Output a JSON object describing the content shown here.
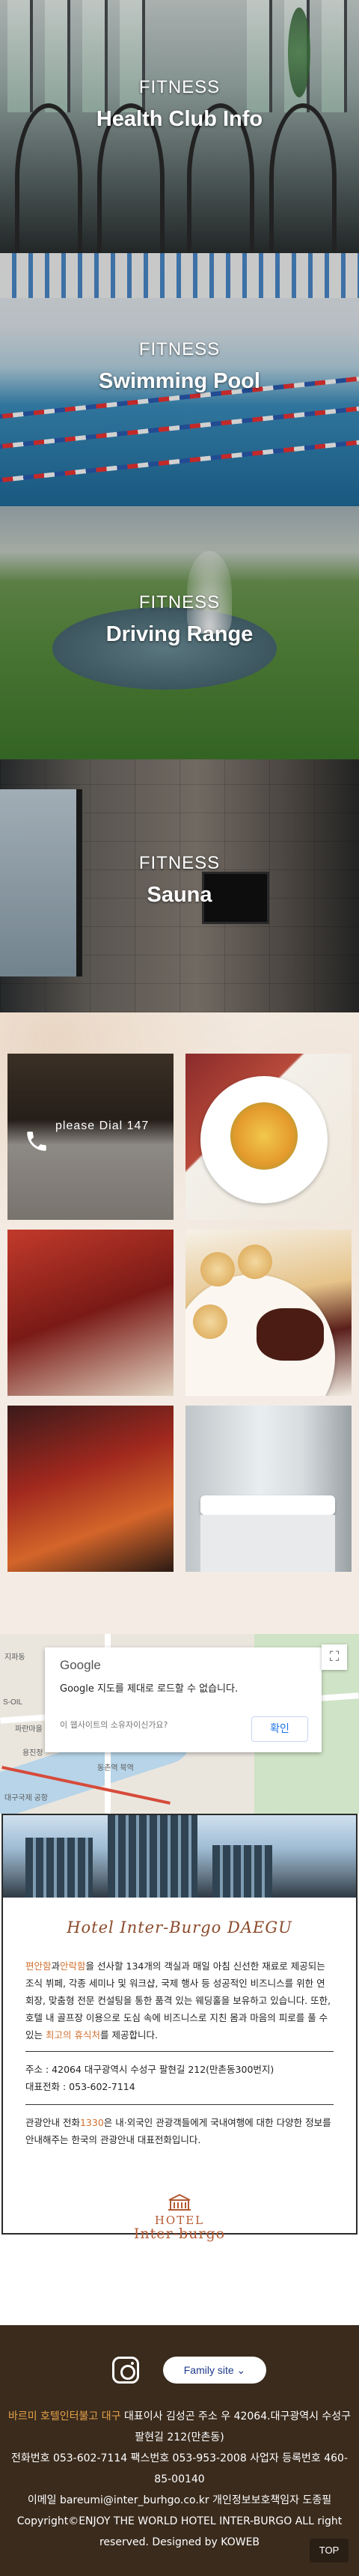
{
  "facilities": [
    {
      "kicker": "FITNESS",
      "title": "Hea­lth Club Info"
    },
    {
      "kicker": "FITNESS",
      "title": "Swimming Pool"
    },
    {
      "kicker": "FITNESS",
      "title": "Driving Range"
    },
    {
      "kicker": "FITNESS",
      "title": "Sauna"
    }
  ],
  "room_service": {
    "dial_text": "please Dial 147",
    "phone_icon": "phone-icon"
  },
  "map": {
    "google_logo": "Google",
    "message": "Google 지도를 제대로 로드할 수 없습니다.",
    "owner_question": "이 웹사이트의 소유자이신가요?",
    "ok_label": "확인",
    "labels": [
      "지파동",
      "S-OIL",
      "파란마을",
      "용진정",
      "동촌역 북역",
      "대구국제 공항"
    ]
  },
  "info": {
    "title": "Hotel Inter-Burgo DAEGU",
    "intro_pre": "",
    "intro_hl1": "편안함",
    "intro_mid1": "과",
    "intro_hl2": "안락함",
    "intro_rest": "을 선사할 134개의 객실과 매일 아침 신선한 재료로 제공되는 조식 뷔페, 각종 세미나 및 워크샵, 국제 행사 등 성공적인 비즈니스를 위한 연회장, 맞춤형 전문 컨설팅을 통한 품격 있는 웨딩홀을 보유하고 있습니다. 또한, 호텔 내 골프장 이용으로 도심 속에 비즈니스로 지친 몸과 마음의 피로를 풀 수 있는",
    "intro_hl3": "최고의 휴식처",
    "intro_end": "를 제공합니다.",
    "address": "주소 : 42064 대구광역시 수성구 팔현길 212(만촌동300번지)",
    "phone": "대표전화 : 053-602-7114",
    "tour_pre": "관광안내 전화",
    "tour_hl": "1330",
    "tour_rest": "은 내·외국인 관광객들에게 국내여행에 대한 다양한 정보를 안내해주는 한국의 관광안내 대표전화입니다.",
    "logo_line1": "HOTEL",
    "logo_line2": "Inter-burgo"
  },
  "footer": {
    "instagram_icon": "instagram-icon",
    "family_site": "Family site ⌄",
    "company_hl": "바르미 호텔인터불고 대구",
    "company_rest": " 대표이사 김성곤 주소 우 42064.대구광역시 수성구 팔현길 212(만촌동)",
    "contact": "전화번호 053-602-7114 팩스번호 053-953-2008 사업자 등록번호 460-85-00140",
    "email": "이메일 bareumi@inter_burhgo.co.kr 개인정보보호책임자 도종필",
    "copyright": "Copyright©ENJOY THE WORLD HOTEL INTER-BURGO ALL right reserved. Designed by KOWEB",
    "top_label": "TOP"
  },
  "colors": {
    "accent": "#d07030",
    "footer_bg": "#3a2b1d",
    "footer_highlight": "#e6a24a",
    "link_blue": "#1a73e8"
  }
}
